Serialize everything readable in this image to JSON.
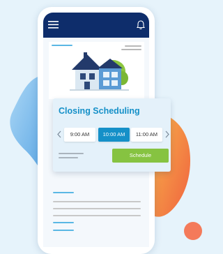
{
  "card": {
    "title": "Closing Scheduling",
    "time_slots": [
      "9:00 AM",
      "10:00 AM",
      "11:00 AM"
    ],
    "selected_slot": "10:00 AM",
    "schedule_label": "Schedule"
  },
  "icons": {
    "menu": "hamburger-menu-icon",
    "notifications": "bell-icon",
    "prev": "chevron-left-icon",
    "next": "chevron-right-icon"
  },
  "colors": {
    "appbar": "#0e2d6b",
    "accent": "#1590c8",
    "button": "#86c341",
    "blob_blue": "#5aa9e6",
    "blob_orange": "#f47a4f"
  }
}
